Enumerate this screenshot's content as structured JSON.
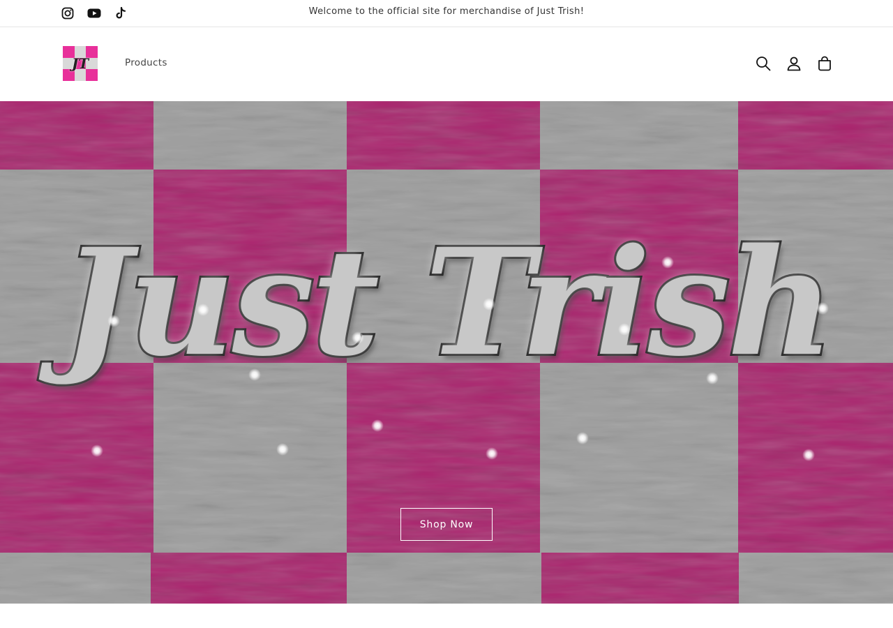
{
  "announcement": {
    "text": "Welcome to the official site for merchandise of Just Trish!"
  },
  "social": [
    {
      "name": "instagram-icon"
    },
    {
      "name": "youtube-icon"
    },
    {
      "name": "tiktok-icon"
    }
  ],
  "header": {
    "logo_initials": "JT",
    "nav": {
      "products_label": "Products"
    },
    "icons": [
      "search-icon",
      "account-icon",
      "cart-icon"
    ]
  },
  "hero": {
    "title": "Just Trish",
    "button_label": "Shop Now"
  },
  "colors": {
    "pink": "#e0288c",
    "fur_gray": "#c9c9c9",
    "text": "#121212"
  }
}
